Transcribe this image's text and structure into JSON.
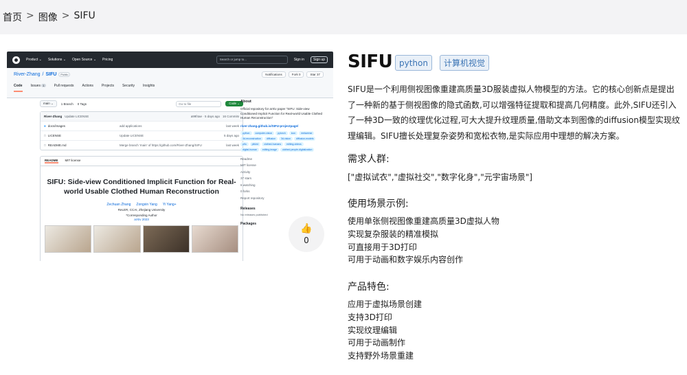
{
  "breadcrumb": {
    "home": "首页",
    "images": "图像",
    "current": "SIFU",
    "sep": ">"
  },
  "screenshot": {
    "nav": {
      "product": "Product ⌄",
      "solutions": "Solutions ⌄",
      "open_source": "Open Source ⌄",
      "pricing": "Pricing",
      "search": "Search or jump to...",
      "signin": "Sign in",
      "signup": "Sign up"
    },
    "repo": {
      "owner": "River-Zhang",
      "slash": "/",
      "name": "SIFU",
      "visibility": "Public",
      "notifications": "Notifications",
      "fork": "Fork 0",
      "star": "Star 37"
    },
    "tabs": {
      "code": "Code",
      "issues": "Issues",
      "issues_count": "1",
      "pulls": "Pull requests",
      "actions": "Actions",
      "projects": "Projects",
      "security": "Security",
      "insights": "Insights"
    },
    "branch": {
      "main": "main ⌄",
      "branches": "1 Branch",
      "tags": "0 Tags",
      "goto": "Go to file",
      "code_btn": "Code ⌄"
    },
    "commit": {
      "author": "River-Zhang",
      "message": "Update LICENSE",
      "meta": "a99f4ae · 5 days ago",
      "commits": "16 Commits"
    },
    "files": [
      {
        "name": "docs/images",
        "msg": "add applications",
        "when": "last week",
        "folder": true
      },
      {
        "name": "LICENSE",
        "msg": "Update LICENSE",
        "when": "5 days ago",
        "folder": false
      },
      {
        "name": "README.md",
        "msg": "Merge branch 'main' of https://github.com/River-Zhang/SIFU",
        "when": "last week",
        "folder": false
      }
    ],
    "readme": {
      "tab_readme": "README",
      "tab_license": "MIT license",
      "title": "SIFU: Side-view Conditioned Implicit Function for Real-world Usable Clothed Human Reconstruction",
      "authors": [
        "Zechuan Zhang",
        "Zongxin Yang",
        "Yi Yang+"
      ],
      "affil1": "ReLER, CCAI, Zhejiang University",
      "affil2": "*Corresponding Author",
      "arxiv": "arXiv 2023"
    },
    "about": {
      "heading": "About",
      "desc": "Official repository for arXiv paper \"SIFU: Side-view Conditioned Implicit Function for Real-world Usable Clothed Human Reconstruction\"",
      "link": "river-zhang.github.io/SIFU-projectpage/",
      "topics": [
        "python",
        "computer-vision",
        "pytorch",
        "icon",
        "metaverse",
        "3d-reconstruction",
        "diffusion",
        "3d-vision",
        "diffusion-models",
        "pifu",
        "pifuhd",
        "clothed-humans",
        "editing-videos",
        "digital-human",
        "editing-image",
        "clothed-people-digitalization"
      ],
      "readme": "Readme",
      "license": "MIT license",
      "activity": "Activity",
      "stars": "37 stars",
      "watching": "6 watching",
      "forks": "0 forks",
      "report": "Report repository",
      "releases": "Releases",
      "no_releases": "No releases published",
      "packages": "Packages"
    },
    "likes": "0"
  },
  "title": "SIFU",
  "tags": [
    "python",
    "计算机视觉"
  ],
  "description": "SIFU是一个利用侧视图像重建高质量3D服装虚拟人物模型的方法。它的核心创新点是提出了一种新的基于侧视图像的隐式函数,可以增强特征提取和提高几何精度。此外,SIFU还引入了一种3D一致的纹理优化过程,可大大提升纹理质量,借助文本到图像的diffusion模型实现纹理编辑。SIFU擅长处理复杂姿势和宽松衣物,是实际应用中理想的解决方案。",
  "audience": {
    "heading": "需求人群:",
    "text": "[\"虚拟试衣\",\"虚拟社交\",\"数字化身\",\"元宇宙场景\"]"
  },
  "usage": {
    "heading": "使用场景示例:",
    "items": [
      "使用单张侧视图像重建高质量3D虚拟人物",
      "实现复杂服装的精准模拟",
      "可直接用于3D打印",
      "可用于动画和数字娱乐内容创作"
    ]
  },
  "features": {
    "heading": "产品特色:",
    "items": [
      "应用于虚拟场景创建",
      "支持3D打印",
      "实现纹理编辑",
      "可用于动画制作",
      "支持野外场景重建"
    ]
  }
}
